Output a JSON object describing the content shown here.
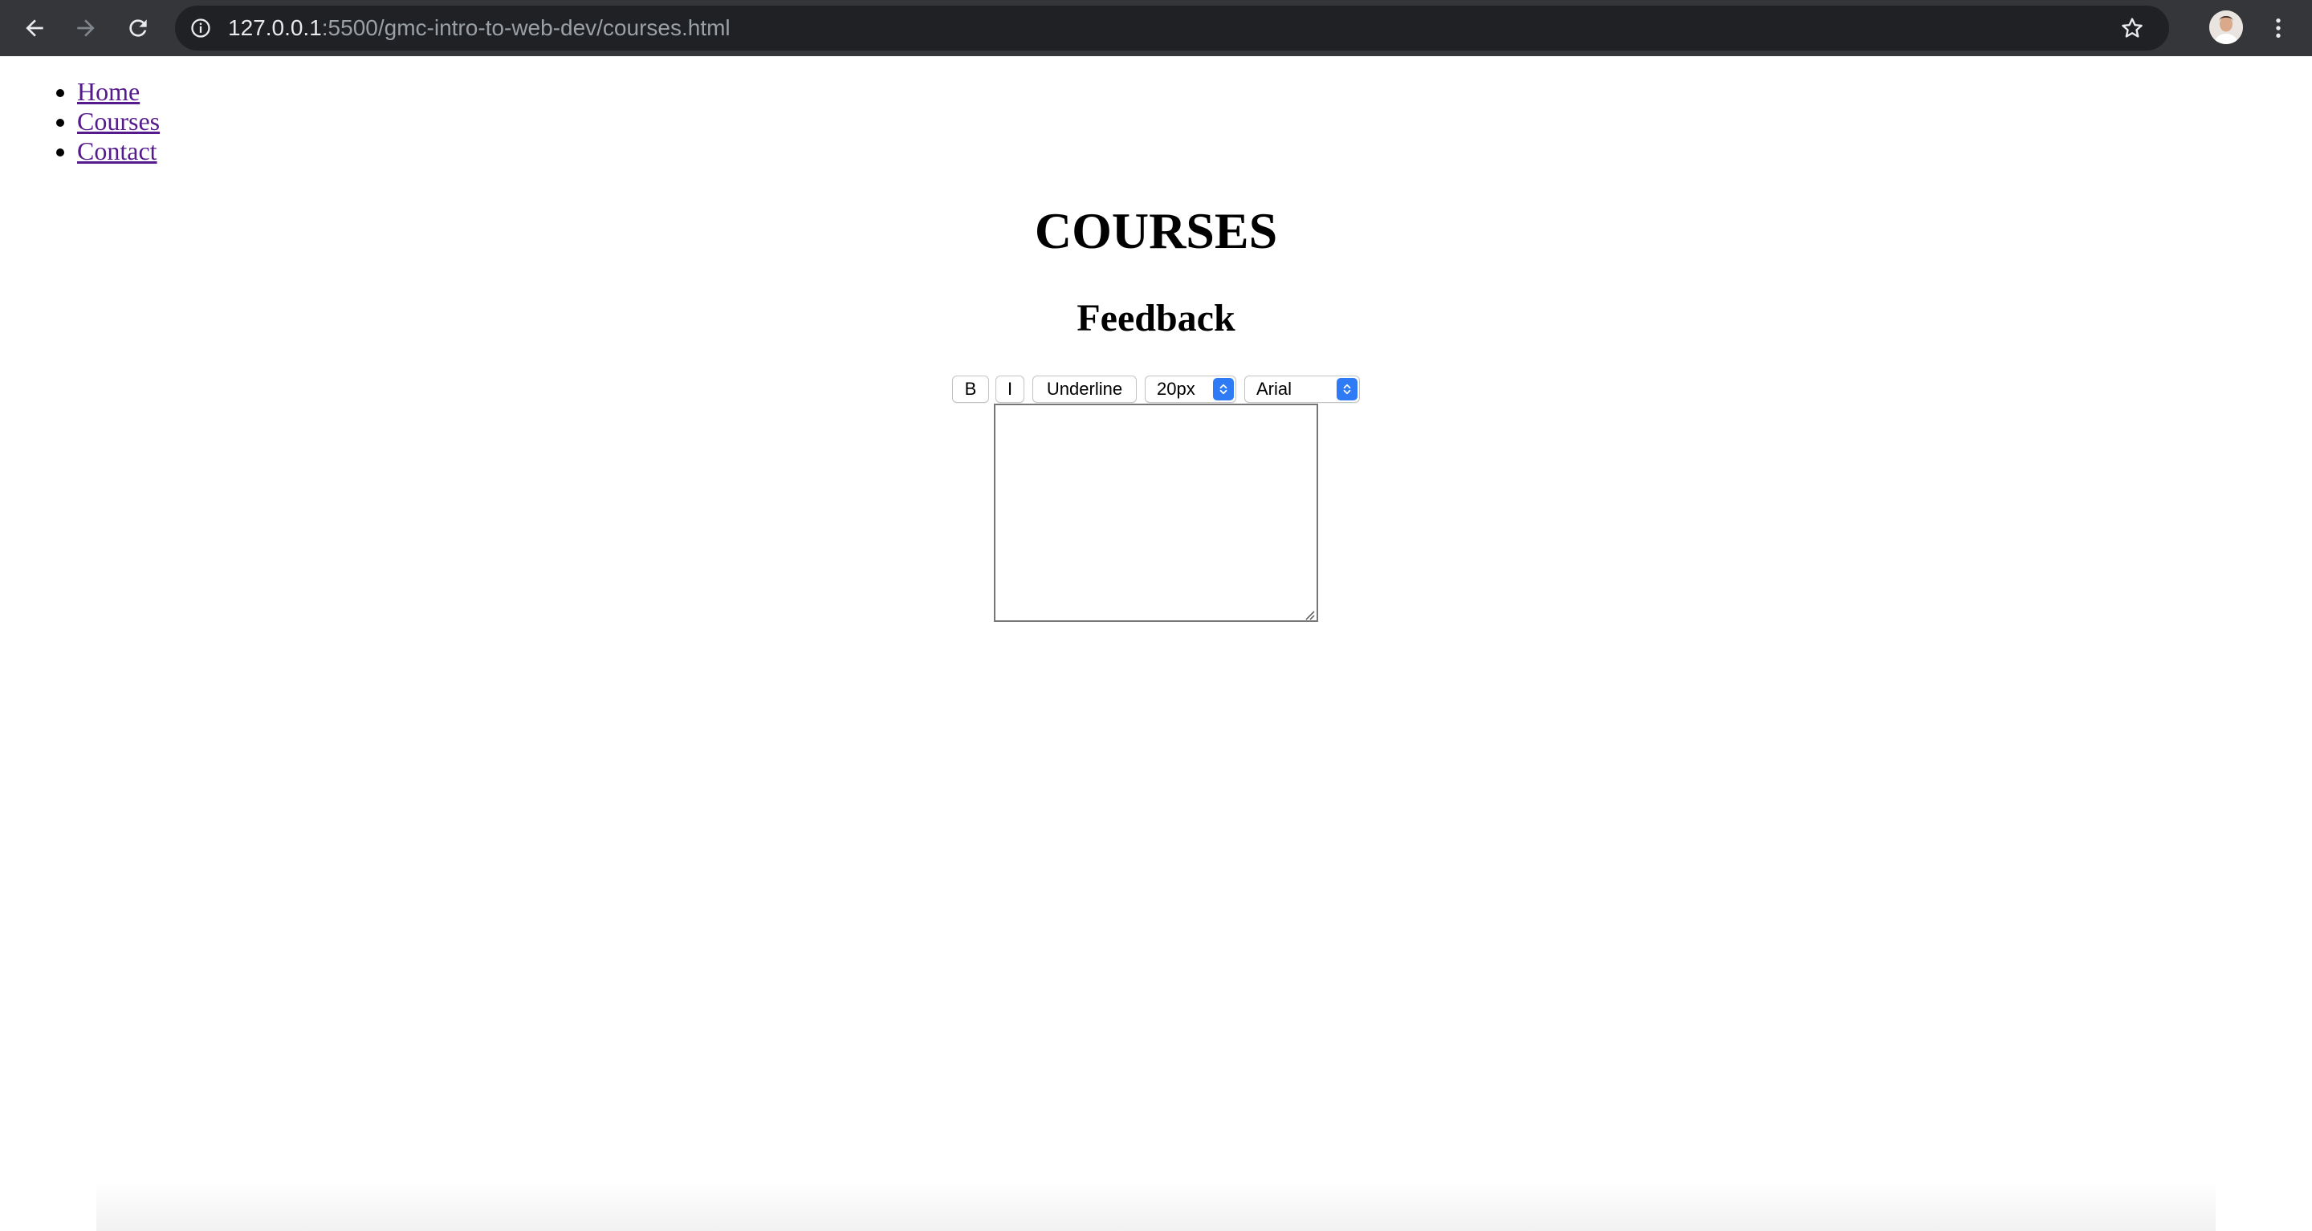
{
  "browser": {
    "url_host": "127.0.0.1",
    "url_path": ":5500/gmc-intro-to-web-dev/courses.html",
    "colors": {
      "toolbar": "#35363a",
      "omnibox": "#202124"
    }
  },
  "nav": {
    "items": [
      {
        "label": "Home"
      },
      {
        "label": "Courses"
      },
      {
        "label": "Contact"
      }
    ],
    "link_color": "#551a8b"
  },
  "main": {
    "title": "COURSES",
    "subtitle": "Feedback"
  },
  "editor": {
    "bold_label": "B",
    "italic_label": "I",
    "underline_label": "Underline",
    "font_size_value": "20px",
    "font_family_value": "Arial",
    "select_accent": "#2f7bf5",
    "textarea_value": ""
  }
}
